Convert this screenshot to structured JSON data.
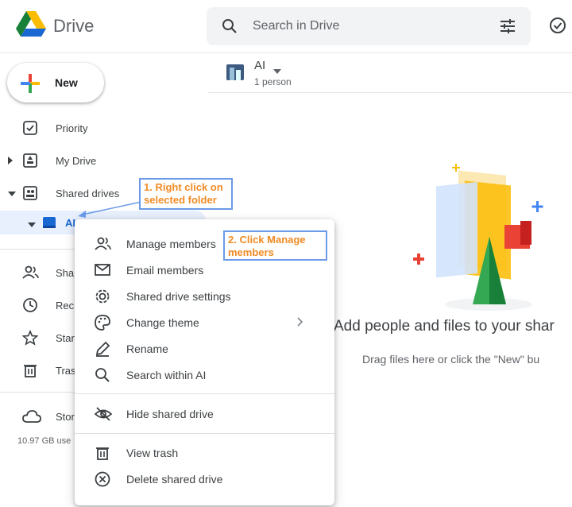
{
  "header": {
    "brand": "Drive",
    "search_placeholder": "Search in Drive"
  },
  "new_button": {
    "label": "New"
  },
  "sidebar": {
    "items": [
      {
        "label": "Priority"
      },
      {
        "label": "My Drive"
      },
      {
        "label": "Shared drives"
      },
      {
        "label": "AI"
      },
      {
        "label": "Sha"
      },
      {
        "label": "Rec"
      },
      {
        "label": "Star"
      },
      {
        "label": "Tras"
      },
      {
        "label": "Stor"
      }
    ],
    "storage_text": "10.97 GB use"
  },
  "folder": {
    "name": "AI",
    "members": "1 person"
  },
  "empty_state": {
    "title": "Add people and files to your shar",
    "subtitle": "Drag files here or click the \"New\" bu"
  },
  "context_menu": {
    "items": [
      {
        "label": "Manage members"
      },
      {
        "label": "Email members"
      },
      {
        "label": "Shared drive settings"
      },
      {
        "label": "Change theme"
      },
      {
        "label": "Rename"
      },
      {
        "label": "Search within AI"
      },
      {
        "label": "Hide shared drive"
      },
      {
        "label": "View trash"
      },
      {
        "label": "Delete shared drive"
      }
    ]
  },
  "annotations": {
    "step1_line1": "1. Right click on",
    "step1_line2": "selected folder",
    "step2_line1": "2. Click Manage",
    "step2_line2": "members"
  },
  "colors": {
    "accent_blue": "#1a73e8",
    "annotation_orange": "#f18b24",
    "annotation_border": "#6b9ae8",
    "selected_bg": "#e8f0fe"
  }
}
